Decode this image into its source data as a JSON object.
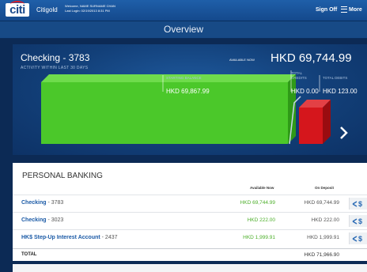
{
  "header": {
    "logo_text": "citi",
    "brand": "Citigold",
    "welcome_line": "Welcome, NAME SURNAME CHAN",
    "last_login_line": "Last Login: 02/19/2013 8:31 PM",
    "signoff_label": "Sign Off",
    "more_label": "More"
  },
  "title": "Overview",
  "chart_panel": {
    "account_name": "Checking - 3783",
    "subtitle": "ACTIVITY WITHIN LAST 30 DAYS",
    "available_label": "AVAILABLE NOW",
    "available_value": "HKD 69,744.99"
  },
  "chart_data": {
    "type": "bar",
    "categories": [
      "STARTING BALANCE",
      "TOTAL CREDITS",
      "TOTAL DEBITS"
    ],
    "category_line1": [
      "STARTING BALANCE",
      "TOTAL",
      "TOTAL DEBITS"
    ],
    "category_line2": [
      "",
      "CREDITS",
      ""
    ],
    "values": [
      69867.99,
      0.0,
      123.0
    ],
    "value_labels": [
      "HKD 69,867.99",
      "HKD 0.00",
      "HKD 123.00"
    ],
    "colors": [
      "#4bc82a",
      "#c8d6e8",
      "#d5161c"
    ],
    "currency": "HKD"
  },
  "banking": {
    "title": "PERSONAL BANKING",
    "col_available": "Available Now",
    "col_deposit": "On Deposit",
    "accounts": [
      {
        "name": "Checking",
        "number": "- 3783",
        "available": "HKD 69,744.99",
        "deposit": "HKD 69,744.99"
      },
      {
        "name": "Checking",
        "number": "- 3023",
        "available": "HKD 222.00",
        "deposit": "HKD 222.00"
      },
      {
        "name": "HK$ Step-Up Interest Account",
        "number": "- 2437",
        "available": "HKD 1,999.91",
        "deposit": "HKD 1,999.91"
      }
    ],
    "transfer_icon": "transfer-arrows-dollar-icon",
    "total_label": "TOTAL",
    "total_value": "HKD 71,966.90"
  }
}
